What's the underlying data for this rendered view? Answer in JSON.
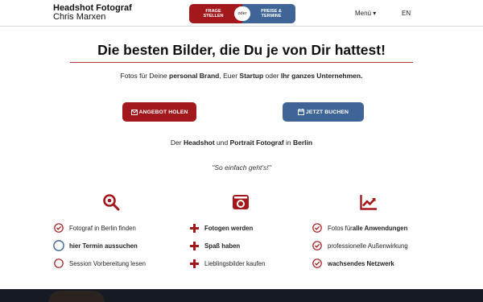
{
  "header": {
    "brand_title": "Headshot Fotograf",
    "brand_subtitle": "Chris Marxen",
    "toggle_left_line1": "FRAGE",
    "toggle_left_line2": "STELLEN",
    "toggle_or": "oder",
    "toggle_right_line1": "PREISE &",
    "toggle_right_line2": "TERMINE",
    "menu_label": "Menü ▾",
    "lang_label": "EN"
  },
  "hero": {
    "headline": "Die besten Bilder, die Du je von Dir hattest!",
    "sub_prefix": "Fotos für Deine ",
    "sub_bold1": "personal Brand",
    "sub_mid1": ", Euer ",
    "sub_bold2": "Startup",
    "sub_mid2": " oder ",
    "sub_bold3": "Ihr ganzes Unternehmen.",
    "offer_button": "ANGEBOT HOLEN",
    "book_button": "JETZT BUCHEN",
    "tag_prefix": "Der ",
    "tag_bold1": "Headshot",
    "tag_mid1": " und ",
    "tag_bold2": "Portrait Fotograf",
    "tag_mid2": " in ",
    "tag_bold3": "Berlin",
    "quote": "\"So einfach geht's!\""
  },
  "features": {
    "col1": {
      "icon": "search-icon",
      "items": [
        "Fotograf in Berlin finden",
        "hier Termin aussuchen",
        "Session Vorbereitung lesen"
      ]
    },
    "col2": {
      "icon": "camera-icon",
      "items": [
        "Fotogen werden",
        "Spaß haben",
        "Lieblingsbilder kaufen"
      ]
    },
    "col3": {
      "icon": "chart-icon",
      "item1_prefix": "Fotos für ",
      "item1_bold": "alle Anwendungen",
      "item2": "professionelle Außenwirkung",
      "item3": "wachsendes Netzwerk"
    }
  },
  "colors": {
    "accent_red": "#a3181c",
    "accent_blue": "#3f6496"
  }
}
